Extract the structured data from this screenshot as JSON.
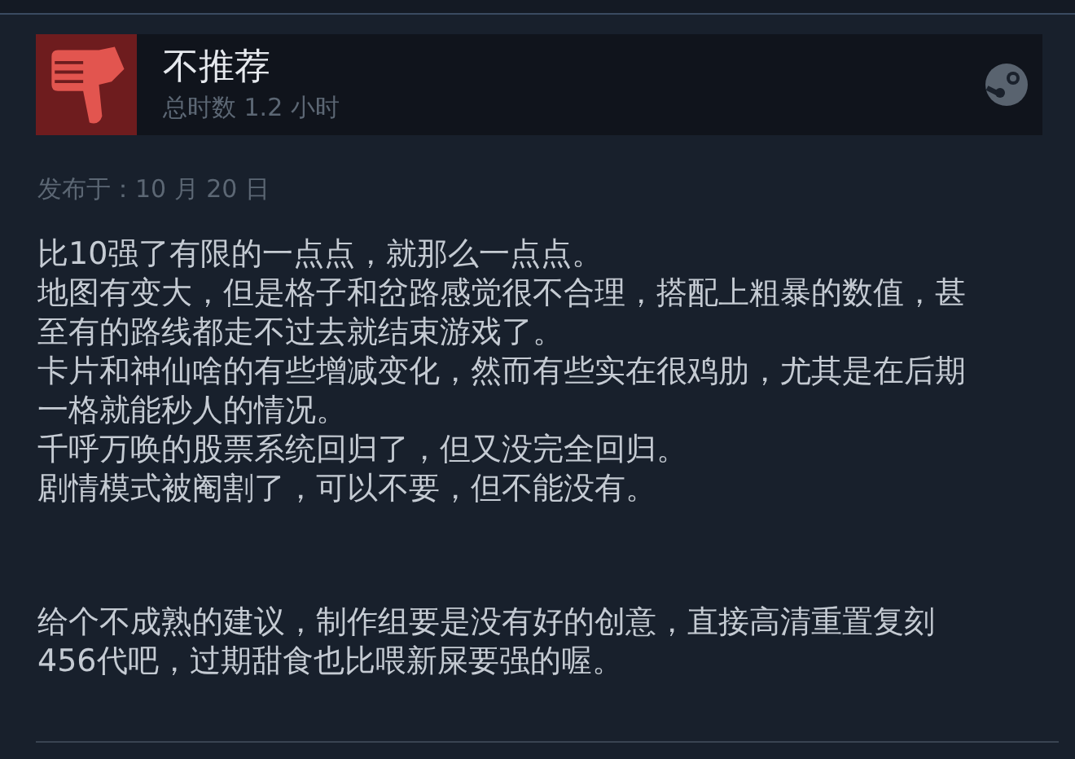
{
  "review": {
    "verdict": "不推荐",
    "playtime": "总时数 1.2 小时",
    "posted": "发布于：10 月 20 日"
  },
  "paragraphs": [
    "比10强了有限的一点点，就那么一点点。",
    "地图有变大，但是格子和岔路感觉很不合理，搭配上粗暴的数值，甚至有的路线都走不过去就结束游戏了。",
    "卡片和神仙啥的有些增减变化，然而有些实在很鸡肋，尤其是在后期一格就能秒人的情况。",
    "千呼万唤的股票系统回归了，但又没完全回归。",
    "剧情模式被阉割了，可以不要，但不能没有。"
  ],
  "suggestion": "给个不成熟的建议，制作组要是没有好的创意，直接高清重置复刻456代吧，过期甜食也比喂新屎要强的喔。"
}
